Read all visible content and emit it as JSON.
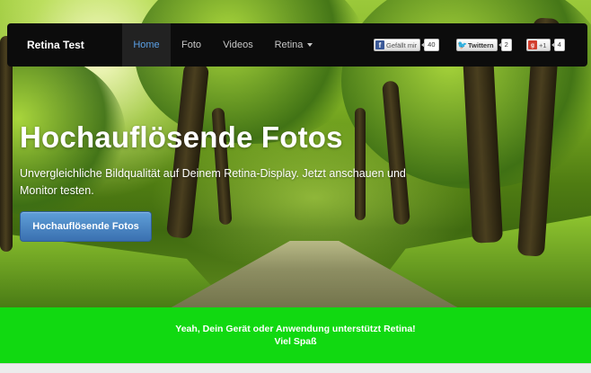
{
  "navbar": {
    "brand": "Retina Test",
    "items": [
      {
        "label": "Home",
        "active": true
      },
      {
        "label": "Foto",
        "active": false
      },
      {
        "label": "Videos",
        "active": false
      },
      {
        "label": "Retina",
        "active": false,
        "dropdown": true
      }
    ],
    "social": {
      "facebook": {
        "icon": "facebook-icon",
        "label": "Gefällt mir",
        "count": "40"
      },
      "twitter": {
        "icon": "twitter-icon",
        "label": "Twittern",
        "count": "2"
      },
      "googleplus": {
        "icon": "google-plus-icon",
        "label": "+1",
        "count": "4"
      }
    }
  },
  "hero": {
    "title": "Hochauflösende Fotos",
    "subtitle": "Unvergleichliche Bildqualität auf Deinem Retina-Display. Jetzt anschauen und Monitor testen.",
    "button_label": "Hochauflösende Fotos"
  },
  "banner": {
    "line1": "Yeah, Dein Gerät oder Anwendung unterstützt Retina!",
    "line2": "Viel Spaß"
  },
  "colors": {
    "navbar_bg": "#0c0c0c",
    "active_link": "#5aa0e6",
    "button_primary": "#3a70b0",
    "banner_green": "#11d911"
  }
}
